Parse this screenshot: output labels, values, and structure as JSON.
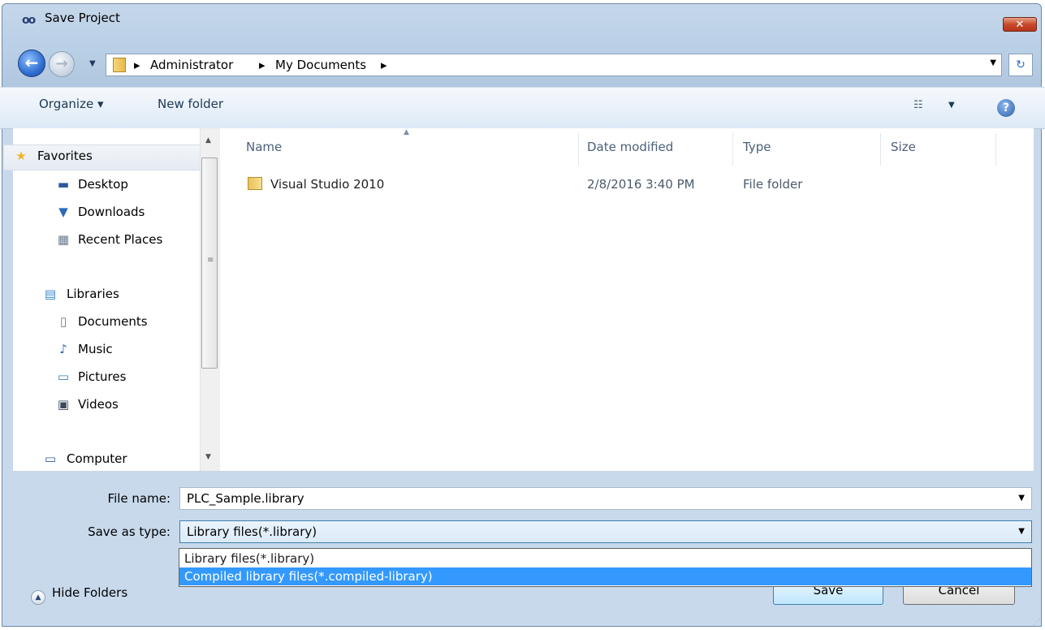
{
  "window": {
    "title": "Save Project",
    "app_icon": "oo",
    "close_label": "✕"
  },
  "navigation": {
    "back_glyph": "←",
    "forward_glyph": "→",
    "recent_glyph": "▼",
    "breadcrumbs": [
      "Administrator",
      "My Documents"
    ],
    "separator": "▸",
    "refresh_glyph": "↻"
  },
  "toolbar": {
    "organize_label": "Organize ▾",
    "new_folder_label": "New folder",
    "view_icon": "☷",
    "view_drop": "▼",
    "help_label": "?"
  },
  "sidebar": {
    "favorites": {
      "label": "Favorites",
      "icon": "★",
      "items": [
        {
          "label": "Desktop",
          "icon": "▬"
        },
        {
          "label": "Downloads",
          "icon": "▼"
        },
        {
          "label": "Recent Places",
          "icon": "▦"
        }
      ]
    },
    "libraries": {
      "label": "Libraries",
      "icon": "▤",
      "items": [
        {
          "label": "Documents",
          "icon": "▯"
        },
        {
          "label": "Music",
          "icon": "♪"
        },
        {
          "label": "Pictures",
          "icon": "▭"
        },
        {
          "label": "Videos",
          "icon": "▣"
        }
      ]
    },
    "computer": {
      "label": "Computer",
      "icon": "▭"
    }
  },
  "file_list": {
    "columns": [
      "Name",
      "Date modified",
      "Type",
      "Size"
    ],
    "sort_glyph": "▲",
    "rows": [
      {
        "name": "Visual Studio 2010",
        "date_modified": "2/8/2016 3:40 PM",
        "type": "File folder",
        "size": ""
      }
    ]
  },
  "form": {
    "file_name_label": "File name:",
    "file_name_value": "PLC_Sample.library",
    "save_type_label": "Save as type:",
    "save_type_value": "Library files(*.library)",
    "save_type_options": [
      "Library files(*.library)",
      "Compiled library files(*.compiled-library)"
    ],
    "highlighted_option_index": 1
  },
  "footer": {
    "hide_folders_label": "Hide Folders",
    "save_label": "Save",
    "cancel_label": "Cancel"
  }
}
